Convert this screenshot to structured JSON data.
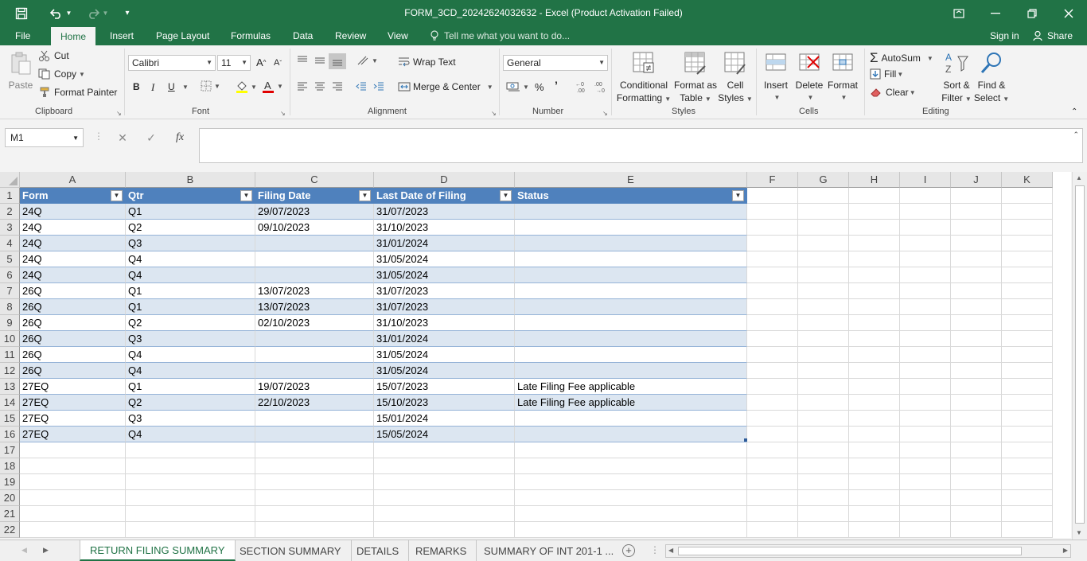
{
  "window": {
    "title": "FORM_3CD_20242624032632 - Excel (Product Activation Failed)"
  },
  "menu": {
    "tabs": [
      "File",
      "Home",
      "Insert",
      "Page Layout",
      "Formulas",
      "Data",
      "Review",
      "View"
    ],
    "active_tab": "Home",
    "tell_me": "Tell me what you want to do...",
    "sign_in": "Sign in",
    "share": "Share"
  },
  "ribbon": {
    "clipboard": {
      "paste": "Paste",
      "cut": "Cut",
      "copy": "Copy",
      "format_painter": "Format Painter",
      "label": "Clipboard"
    },
    "font": {
      "name": "Calibri",
      "size": "11",
      "bold": "B",
      "italic": "I",
      "underline": "U",
      "label": "Font"
    },
    "alignment": {
      "wrap_text": "Wrap Text",
      "merge_center": "Merge & Center",
      "label": "Alignment"
    },
    "number": {
      "format": "General",
      "percent": "%",
      "comma": "’",
      "label": "Number"
    },
    "styles": {
      "conditional": "Conditional",
      "conditional2": "Formatting",
      "format_as": "Format as",
      "format_as2": "Table",
      "cell": "Cell",
      "cell2": "Styles",
      "label": "Styles"
    },
    "cells": {
      "insert": "Insert",
      "delete": "Delete",
      "format": "Format",
      "label": "Cells"
    },
    "editing": {
      "autosum": "AutoSum",
      "fill": "Fill",
      "clear": "Clear",
      "sort": "Sort &",
      "sort2": "Filter",
      "find": "Find &",
      "find2": "Select",
      "label": "Editing"
    }
  },
  "formula_bar": {
    "name_box": "M1",
    "fx": "fx",
    "content": ""
  },
  "columns": [
    "A",
    "B",
    "C",
    "D",
    "E",
    "F",
    "G",
    "H",
    "I",
    "J",
    "K"
  ],
  "row_numbers": [
    "1",
    "2",
    "3",
    "4",
    "5",
    "6",
    "7",
    "8",
    "9",
    "10",
    "11",
    "12",
    "13",
    "14",
    "15",
    "16",
    "17",
    "18",
    "19",
    "20",
    "21",
    "22"
  ],
  "table": {
    "headers": [
      "Form",
      "Qtr",
      "Filing Date",
      "Last Date of Filing",
      "Status"
    ],
    "rows": [
      [
        "24Q",
        "Q1",
        "29/07/2023",
        "31/07/2023",
        ""
      ],
      [
        "24Q",
        "Q2",
        "09/10/2023",
        "31/10/2023",
        ""
      ],
      [
        "24Q",
        "Q3",
        "",
        "31/01/2024",
        ""
      ],
      [
        "24Q",
        "Q4",
        "",
        "31/05/2024",
        ""
      ],
      [
        "24Q",
        "Q4",
        "",
        "31/05/2024",
        ""
      ],
      [
        "26Q",
        "Q1",
        "13/07/2023",
        "31/07/2023",
        ""
      ],
      [
        "26Q",
        "Q1",
        "13/07/2023",
        "31/07/2023",
        ""
      ],
      [
        "26Q",
        "Q2",
        "02/10/2023",
        "31/10/2023",
        ""
      ],
      [
        "26Q",
        "Q3",
        "",
        "31/01/2024",
        ""
      ],
      [
        "26Q",
        "Q4",
        "",
        "31/05/2024",
        ""
      ],
      [
        "26Q",
        "Q4",
        "",
        "31/05/2024",
        ""
      ],
      [
        "27EQ",
        "Q1",
        "19/07/2023",
        "15/07/2023",
        "Late Filing Fee applicable"
      ],
      [
        "27EQ",
        "Q2",
        "22/10/2023",
        "15/10/2023",
        "Late Filing Fee applicable"
      ],
      [
        "27EQ",
        "Q3",
        "",
        "15/01/2024",
        ""
      ],
      [
        "27EQ",
        "Q4",
        "",
        "15/05/2024",
        ""
      ]
    ]
  },
  "sheets": {
    "tabs": [
      "RETURN FILING SUMMARY",
      "SECTION SUMMARY",
      "DETAILS",
      "REMARKS",
      "SUMMARY OF INT 201-1 ..."
    ],
    "active": "RETURN FILING SUMMARY"
  },
  "colors": {
    "excel_green": "#217346",
    "table_header": "#4f81bd",
    "table_band": "#dce6f1"
  }
}
